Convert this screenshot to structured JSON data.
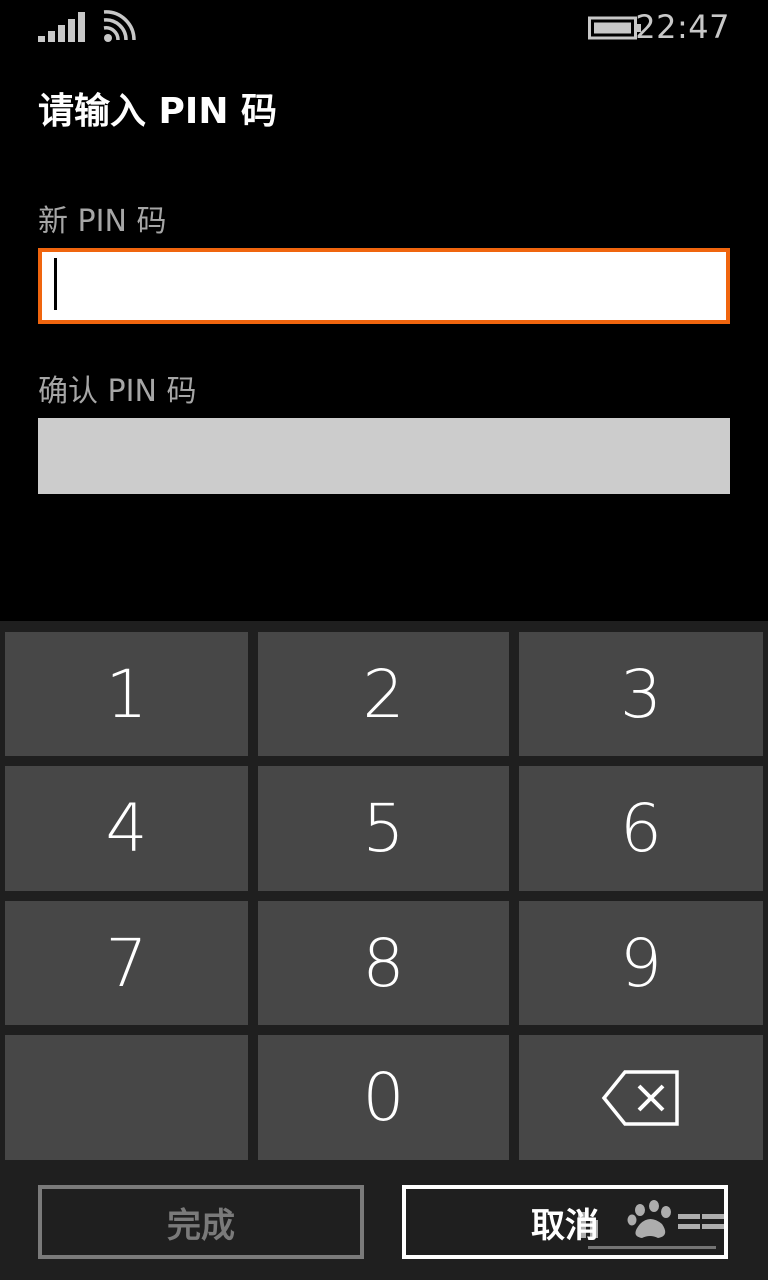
{
  "status_bar": {
    "time": "22:47",
    "signal_icon": "signal-bars-icon",
    "wifi_icon": "wifi-icon",
    "battery_icon": "battery-icon"
  },
  "page": {
    "title": "请输入 PIN 码"
  },
  "fields": {
    "new_pin_label": "新 PIN 码",
    "new_pin_value": "",
    "confirm_pin_label": "确认 PIN 码",
    "confirm_pin_value": ""
  },
  "keypad": {
    "keys": [
      "1",
      "2",
      "3",
      "4",
      "5",
      "6",
      "7",
      "8",
      "9",
      "",
      "0"
    ],
    "backspace_icon": "backspace-icon"
  },
  "actions": {
    "done_label": "完成",
    "cancel_label": "取消"
  },
  "colors": {
    "accent": "#f0650e",
    "key_background": "#474747",
    "keypad_background": "#1f1f1f",
    "disabled_input": "#cccccc"
  }
}
